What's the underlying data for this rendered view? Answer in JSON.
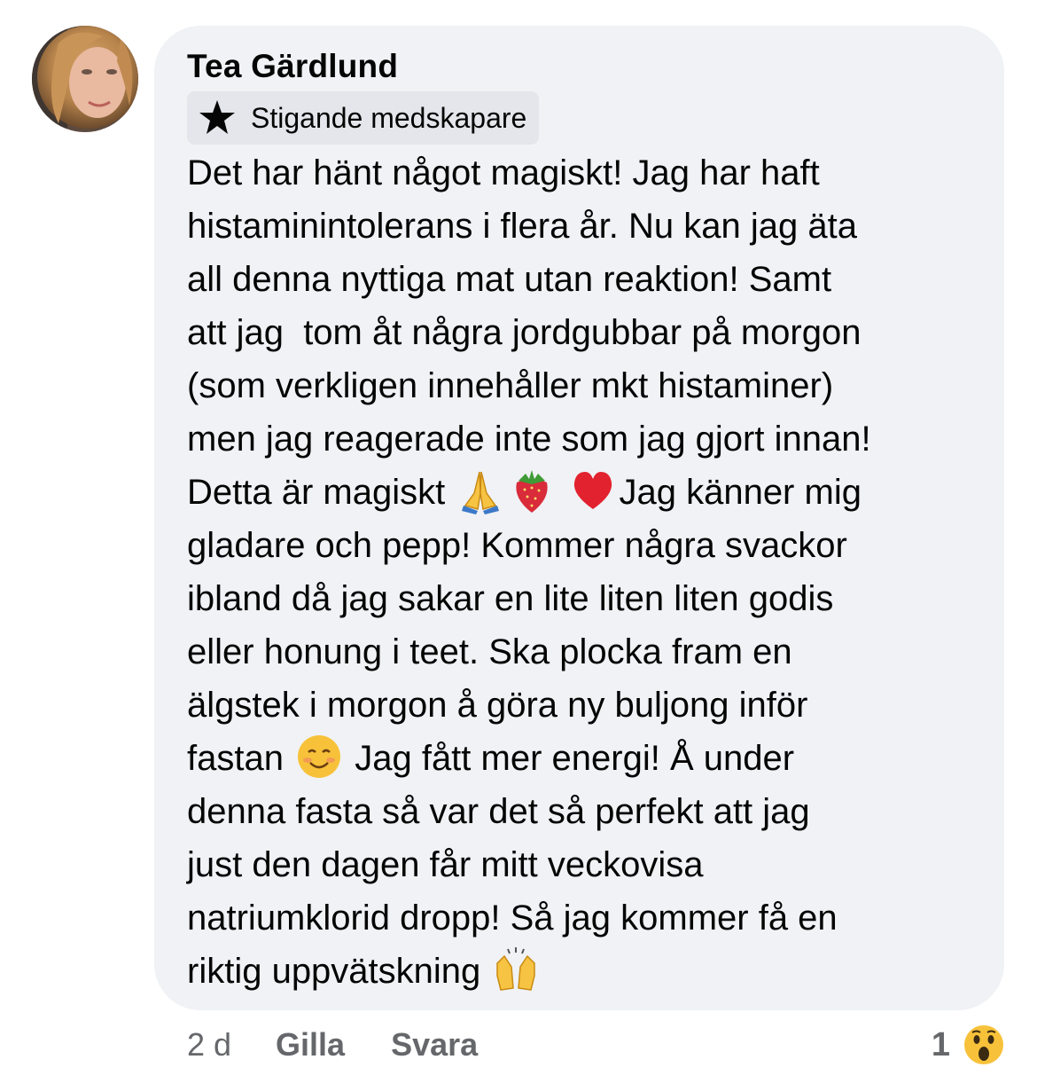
{
  "comment": {
    "author": "Tea Gärdlund",
    "badge": {
      "icon": "star-icon",
      "label": "Stigande medskapare"
    },
    "lines": [
      "Det har hänt något magiskt! Jag har haft",
      "histaminintolerans i flera år. Nu kan jag äta",
      "all denna nyttiga mat utan reaktion! Samt",
      "att jag  tom åt några jordgubbar på morgon",
      "(som verkligen innehåller mkt histaminer)",
      "men jag reagerade inte som jag gjort innan!",
      "Detta är magiskt",
      "Jag känner mig",
      "gladare och pepp! Kommer några svackor",
      "ibland då jag sakar en lite liten liten godis",
      "eller honung i teet. Ska plocka fram en",
      "älgstek i morgon å göra ny buljong inför",
      "fastan",
      "Jag fått mer energi! Å under",
      "denna fasta så var det så perfekt att jag",
      "just den dagen får mitt veckovisa",
      "natriumklorid dropp! Så jag kommer få en",
      "riktig uppvätskning"
    ],
    "emojis": [
      "folded-hands-emoji",
      "strawberry-emoji",
      "red-heart-emoji",
      "smiling-face-emoji",
      "raising-hands-emoji"
    ]
  },
  "actions": {
    "time": "2 d",
    "like_label": "Gilla",
    "reply_label": "Svara"
  },
  "reactions": {
    "count": "1",
    "icon": "wow-reaction-icon"
  },
  "colors": {
    "bubble": "#f0f2f5",
    "badge": "#e4e6eb",
    "secondary_text": "#65676b",
    "text": "#050505"
  }
}
